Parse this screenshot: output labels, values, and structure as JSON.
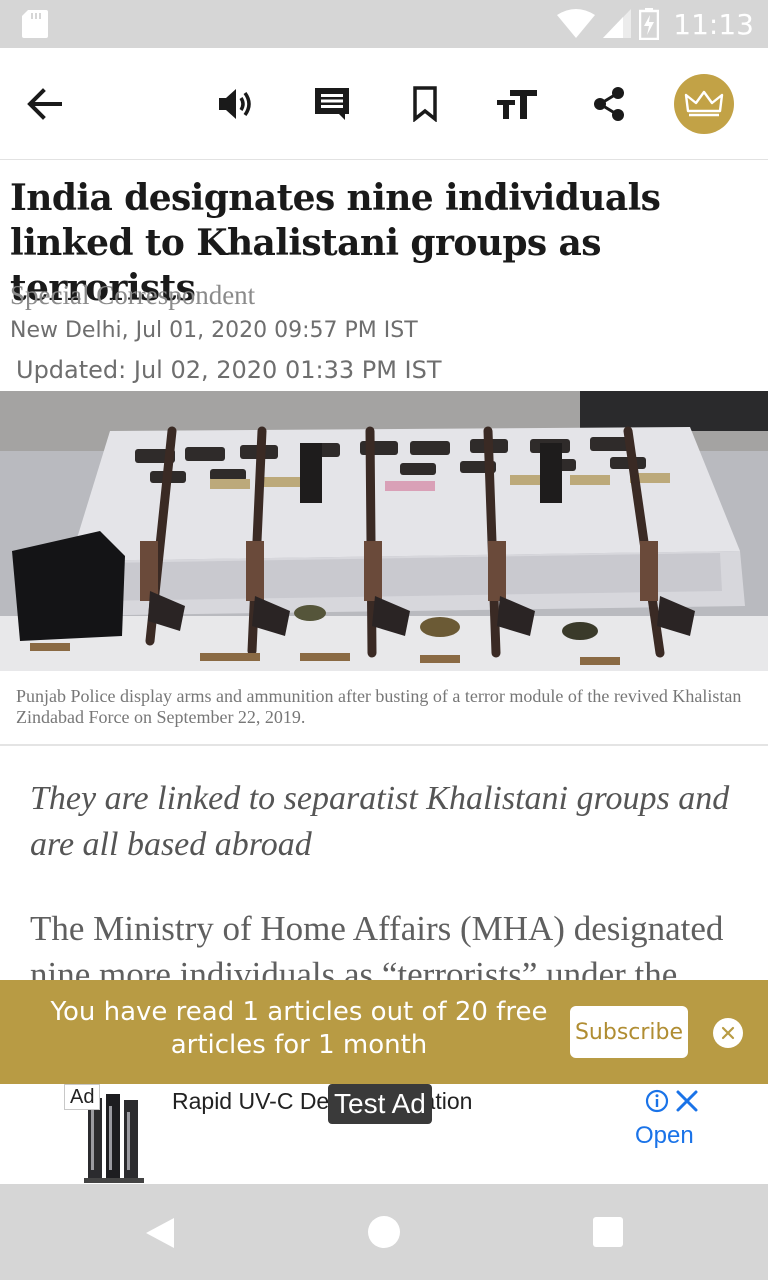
{
  "status_bar": {
    "time": "11:13",
    "icons": [
      "sd-card-icon",
      "wifi-icon",
      "signal-icon",
      "battery-icon"
    ]
  },
  "toolbar": {
    "icons": [
      "back-arrow-icon",
      "speaker-icon",
      "comment-icon",
      "bookmark-icon",
      "text-size-icon",
      "share-icon",
      "crown-icon"
    ]
  },
  "article": {
    "headline": "India designates nine individuals linked to Khalistani groups as terrorists",
    "author": "Special Correspondent",
    "dateline": "New Delhi,  Jul 01, 2020 09:57 PM IST",
    "updated": "Updated: Jul 02, 2020 01:33 PM IST",
    "photo_caption": "Punjab Police display arms and ammunition after busting of a terror module of the revived Khalistan Zindabad Force on September 22, 2019.",
    "standfirst": "They are linked to separatist Khalistani groups and are all based abroad",
    "body": "The Ministry of Home Affairs (MHA) designated nine more individuals as “terrorists” under the"
  },
  "paywall": {
    "message": "You have read 1 articles out of 20 free articles for 1 month",
    "subscribe_label": "Subscribe"
  },
  "ad": {
    "badge": "Ad",
    "title": "Rapid UV-C Decontamination",
    "test_label": "Test Ad",
    "open_label": "Open"
  },
  "colors": {
    "accent_gold": "#b89b44",
    "crown_gold": "#c2a246",
    "ad_blue": "#1a73e8"
  }
}
